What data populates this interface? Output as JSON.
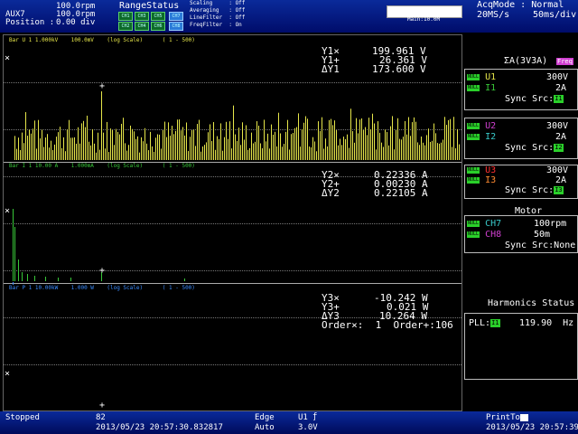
{
  "header": {
    "aux_line1": "100.0rpm",
    "aux_name": "AUX7",
    "aux_line2": "100.0rpm",
    "position_label": "Position :",
    "position_value": "0.00 div",
    "range_status_title": "RangeStatus",
    "channels": [
      "CH1",
      "CH3",
      "CH5",
      "CH7",
      "CH2",
      "CH4",
      "CH6",
      "CH8"
    ],
    "scaling": "Scaling     : Off",
    "averaging": "Averaging   : Off",
    "linefilter": "LineFilter  : Off",
    "freqfilter": "FreqFilter  : On",
    "zoom_label": "Main:10.0M",
    "acq_mode": "AcqMode : Normal",
    "sample_rate": "20MS/s",
    "timebase": "50ms/div"
  },
  "panels": [
    {
      "header": "Bar U 1 1.000kV    100.0mV    (log Scale)      ( 1 - 500)",
      "color": "#e6e64a",
      "meas": [
        {
          "label": "Y1×",
          "value": "199.961 V"
        },
        {
          "label": "Y1+",
          "value": "26.361 V"
        },
        {
          "label": "ΔY1",
          "value": "173.600 V"
        }
      ]
    },
    {
      "header": "Bar I 1 10.00 A    1.000mA    (log Scale)      ( 1 - 500)",
      "color": "#38c838",
      "meas": [
        {
          "label": "Y2×",
          "value": "0.22336 A"
        },
        {
          "label": "Y2+",
          "value": "0.00230 A"
        },
        {
          "label": "ΔY2",
          "value": "0.22105 A"
        }
      ]
    },
    {
      "header": "Bar P 1 10.00kW    1.000 W    (log Scale)      ( 1 - 500)",
      "color": "#3a8cff",
      "meas": [
        {
          "label": "Y3×",
          "value": "-10.242 W"
        },
        {
          "label": "Y3+",
          "value": "0.021 W"
        },
        {
          "label": "ΔY3",
          "value": "10.264 W"
        }
      ],
      "order_line": "Order×:  1  Order+:106"
    }
  ],
  "markers": {
    "x": "×",
    "plus": "+"
  },
  "right_panel": {
    "sigma_title": "ΣA(3V3A)",
    "sigma_badge": "Freq",
    "elements": [
      {
        "tag": "NULL",
        "ch": "U1",
        "ch_color": "#e6e64a",
        "val": "300V",
        "tag2": "NULL",
        "ch2": "I1",
        "ch2_color": "#38c838",
        "val2": "2A",
        "sync": "Sync Src:",
        "sync_tag": "I1"
      },
      {
        "tag": "NULL",
        "ch": "U2",
        "ch_color": "#d040d0",
        "val": "300V",
        "tag2": "NULL",
        "ch2": "I2",
        "ch2_color": "#38c8c8",
        "val2": "2A",
        "sync": "Sync Src:",
        "sync_tag": "I2"
      },
      {
        "tag": "NULL",
        "ch": "U3",
        "ch_color": "#ff3030",
        "val": "300V",
        "tag2": "NULL",
        "ch2": "I3",
        "ch2_color": "#ff8a30",
        "val2": "2A",
        "sync": "Sync Src:",
        "sync_tag": "I3"
      }
    ],
    "motor_title": "Motor",
    "motor_lines": [
      {
        "tag": "NULL",
        "ch": "CH7",
        "ch_color": "#38c8c8",
        "val": "100rpm"
      },
      {
        "tag": "NULL",
        "ch": "CH8",
        "ch_color": "#d040d0",
        "val": "50m"
      }
    ],
    "motor_sync": "Sync Src:None",
    "harmonics_title": "Harmonics Status",
    "pll_label": "PLL:",
    "pll_tag": "I1",
    "pll_value": "119.90  Hz"
  },
  "bottom": {
    "status": "Stopped",
    "count": "82",
    "timestamp": "2013/05/23 20:57:30.832817",
    "trigger_type": "Edge",
    "trigger_mode": "Auto",
    "trigger_src": "U1",
    "trigger_level": "3.0V",
    "print_label": "PrintTo",
    "clock": "2013/05/23 20:57:39"
  }
}
